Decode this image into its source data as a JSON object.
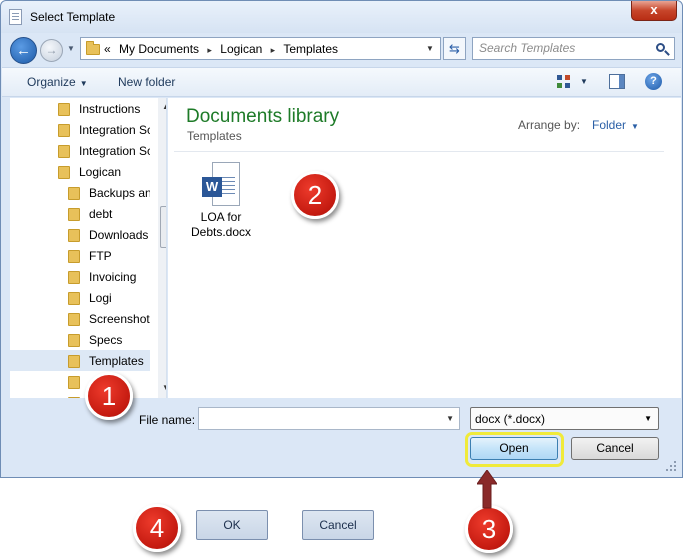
{
  "window": {
    "title": "Select Template",
    "close_glyph": "x"
  },
  "address": {
    "prefix": "«",
    "breadcrumbs": [
      "My Documents",
      "Logican",
      "Templates"
    ],
    "separator": "▸"
  },
  "search": {
    "placeholder": "Search Templates"
  },
  "toolbar": {
    "organize_label": "Organize",
    "new_folder_label": "New folder"
  },
  "nav_tree": [
    {
      "label": "Instructions",
      "indent": 0
    },
    {
      "label": "Integration Sc",
      "indent": 0
    },
    {
      "label": "Integration Sc",
      "indent": 0
    },
    {
      "label": "Logican",
      "indent": 0
    },
    {
      "label": "Backups an",
      "indent": 1
    },
    {
      "label": "debt",
      "indent": 1
    },
    {
      "label": "Downloads",
      "indent": 1
    },
    {
      "label": "FTP",
      "indent": 1
    },
    {
      "label": "Invoicing",
      "indent": 1
    },
    {
      "label": "Logi",
      "indent": 1
    },
    {
      "label": "Screenshot",
      "indent": 1
    },
    {
      "label": "Specs",
      "indent": 1
    },
    {
      "label": "Templates",
      "indent": 1,
      "selected": true
    },
    {
      "label": "",
      "indent": 1
    },
    {
      "label": "",
      "indent": 1
    }
  ],
  "library": {
    "title": "Documents library",
    "subtitle": "Templates",
    "arrange_label": "Arrange by:",
    "arrange_value": "Folder"
  },
  "files": [
    {
      "name_line1": "LOA for",
      "name_line2": "Debts.docx",
      "icon": "word-document-icon",
      "badge": "W"
    }
  ],
  "bottom": {
    "file_name_label": "File name:",
    "file_name_value": "",
    "filter_value": "docx (*.docx)",
    "open_label": "Open",
    "cancel_label": "Cancel"
  },
  "outer_buttons": {
    "ok_label": "OK",
    "cancel_label": "Cancel"
  },
  "callouts": [
    "1",
    "2",
    "3",
    "4"
  ],
  "colors": {
    "accent_library_title": "#1e7b28",
    "callout_red": "#c41a10",
    "highlight_yellow": "#f0ea3a",
    "arrow_maroon": "#8a2a2a"
  }
}
